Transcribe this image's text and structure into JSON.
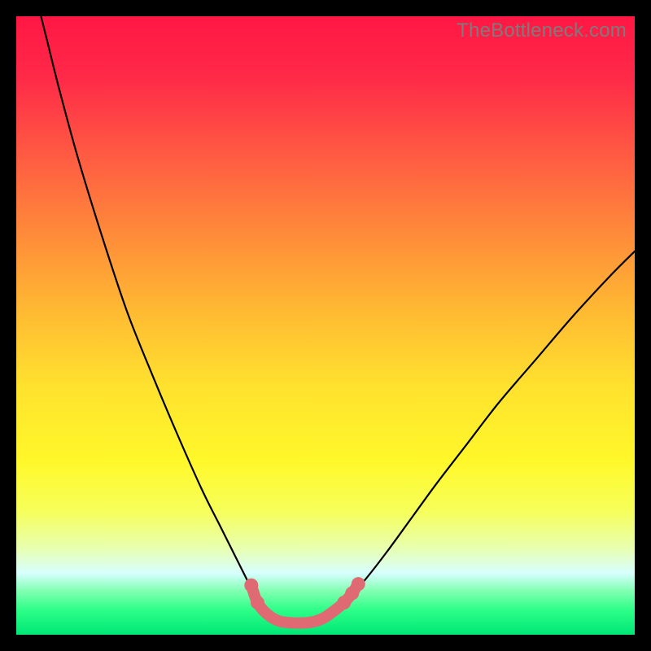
{
  "watermark": {
    "text": "TheBottleneck.com"
  },
  "chart_data": {
    "type": "line",
    "title": "",
    "xlabel": "",
    "ylabel": "",
    "xlim": [
      0,
      100
    ],
    "ylim": [
      0,
      100
    ],
    "gradient_stops": [
      {
        "offset": 0.0,
        "color": "#ff1744"
      },
      {
        "offset": 0.1,
        "color": "#ff2a48"
      },
      {
        "offset": 0.22,
        "color": "#ff5943"
      },
      {
        "offset": 0.35,
        "color": "#ff8a3a"
      },
      {
        "offset": 0.48,
        "color": "#ffbb33"
      },
      {
        "offset": 0.6,
        "color": "#ffe22e"
      },
      {
        "offset": 0.72,
        "color": "#fff82a"
      },
      {
        "offset": 0.8,
        "color": "#f6ff5a"
      },
      {
        "offset": 0.86,
        "color": "#e8ffb0"
      },
      {
        "offset": 0.9,
        "color": "#d8ffff"
      },
      {
        "offset": 0.93,
        "color": "#7fffb0"
      },
      {
        "offset": 0.96,
        "color": "#2dff88"
      },
      {
        "offset": 1.0,
        "color": "#00e676"
      }
    ],
    "series": [
      {
        "name": "bottleneck-curve",
        "color": "#000000",
        "width": 2.2,
        "points": [
          {
            "x": 4.0,
            "y": 100.0
          },
          {
            "x": 5.0,
            "y": 96.0
          },
          {
            "x": 7.0,
            "y": 88.0
          },
          {
            "x": 10.0,
            "y": 77.0
          },
          {
            "x": 14.0,
            "y": 64.0
          },
          {
            "x": 18.0,
            "y": 52.0
          },
          {
            "x": 22.0,
            "y": 42.0
          },
          {
            "x": 26.0,
            "y": 32.5
          },
          {
            "x": 30.0,
            "y": 23.5
          },
          {
            "x": 33.0,
            "y": 17.5
          },
          {
            "x": 35.5,
            "y": 12.5
          },
          {
            "x": 37.5,
            "y": 8.5
          },
          {
            "x": 39.0,
            "y": 5.5
          },
          {
            "x": 40.5,
            "y": 3.3
          },
          {
            "x": 42.0,
            "y": 2.2
          },
          {
            "x": 44.0,
            "y": 1.9
          },
          {
            "x": 46.0,
            "y": 1.9
          },
          {
            "x": 48.0,
            "y": 2.1
          },
          {
            "x": 50.0,
            "y": 2.8
          },
          {
            "x": 52.0,
            "y": 4.2
          },
          {
            "x": 54.0,
            "y": 6.2
          },
          {
            "x": 56.5,
            "y": 9.0
          },
          {
            "x": 60.0,
            "y": 13.5
          },
          {
            "x": 64.0,
            "y": 19.0
          },
          {
            "x": 68.0,
            "y": 24.5
          },
          {
            "x": 73.0,
            "y": 31.0
          },
          {
            "x": 78.0,
            "y": 37.5
          },
          {
            "x": 84.0,
            "y": 44.5
          },
          {
            "x": 90.0,
            "y": 51.5
          },
          {
            "x": 96.0,
            "y": 58.0
          },
          {
            "x": 100.0,
            "y": 62.0
          }
        ]
      },
      {
        "name": "blob-outline",
        "color": "#e06a74",
        "width": 14,
        "dot_radius": 8.5,
        "points": [
          {
            "x": 38.0,
            "y": 8.0
          },
          {
            "x": 39.0,
            "y": 5.2
          },
          {
            "x": 40.5,
            "y": 3.4
          },
          {
            "x": 42.5,
            "y": 2.2
          },
          {
            "x": 45.0,
            "y": 1.9
          },
          {
            "x": 47.5,
            "y": 2.0
          },
          {
            "x": 49.5,
            "y": 2.6
          },
          {
            "x": 51.3,
            "y": 3.8
          },
          {
            "x": 53.0,
            "y": 5.2
          },
          {
            "x": 54.3,
            "y": 6.7
          },
          {
            "x": 55.3,
            "y": 8.2
          }
        ]
      }
    ]
  }
}
